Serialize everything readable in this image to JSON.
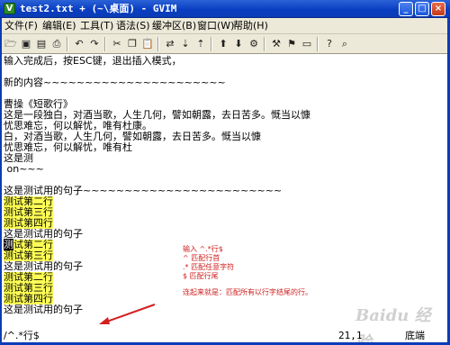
{
  "window": {
    "title": "test2.txt + (~\\桌面) - GVIM",
    "buttons": [
      "_",
      "□",
      "×"
    ]
  },
  "menu": [
    "文件(F)",
    "编辑(E)",
    "工具(T)",
    "语法(S)",
    "缓冲区(B)",
    "窗口(W)",
    "帮助(H)"
  ],
  "toolbar_icons": [
    "open-icon",
    "save-icon",
    "save-all-icon",
    "print-icon",
    "undo-icon",
    "redo-icon",
    "cut-icon",
    "copy-icon",
    "paste-icon",
    "find-icon",
    "find-next-icon",
    "find-prev-icon",
    "replace-icon",
    "load-session-icon",
    "save-session-icon",
    "run-script-icon",
    "make-icon",
    "run-ctags-icon",
    "jump-tag-icon",
    "help-icon",
    "find-help-icon"
  ],
  "editor": {
    "lines": [
      {
        "text": "输入完成后，按ESC键，退出插入模式，",
        "hl": false
      },
      {
        "text": "",
        "hl": false
      },
      {
        "text": "新的内容~~~~~~~~~~~~~~~~~~~~~~",
        "hl": false
      },
      {
        "text": "",
        "hl": false
      },
      {
        "text": "曹操《短歌行》",
        "hl": false
      },
      {
        "text": "这是一段独白，对酒当歌，人生几何，譬如朝露，去日苦多。慨当以慷",
        "hl": false
      },
      {
        "text": "忧思难忘，何以解忧，唯有杜康。",
        "hl": false
      },
      {
        "text": "白，对酒当歌，人生几何，譬如朝露，去日苦多。慨当以慷",
        "hl": false
      },
      {
        "text": "忧思难忘，何以解忧，唯有杜",
        "hl": false
      },
      {
        "text": "这是测",
        "hl": false
      },
      {
        "text": " on~~~",
        "hl": false
      },
      {
        "text": "",
        "hl": false
      },
      {
        "text": "这是测试用的句子~~~~~~~~~~~~~~~~~~~~~~~~",
        "hl": false
      },
      {
        "text": "测试第二行",
        "hl": true
      },
      {
        "text": "测试第三行",
        "hl": true
      },
      {
        "text": "测试第四行",
        "hl": true
      },
      {
        "text": "这是测试用的句子",
        "hl": false
      },
      {
        "text": "测试第二行",
        "hl": true,
        "cursor": true
      },
      {
        "text": "测试第三行",
        "hl": true
      },
      {
        "text": "这是测试用的句子",
        "hl": false
      },
      {
        "text": "测试第二行",
        "hl": true
      },
      {
        "text": "测试第三行",
        "hl": true
      },
      {
        "text": "测试第四行",
        "hl": true
      },
      {
        "text": "这是测试用的句子",
        "hl": false
      }
    ],
    "cursor_char": "测",
    "cursor_rest": "试第二行"
  },
  "annotation": {
    "lines": [
      "输入 ^.*行$",
      "^ 匹配行首",
      ".* 匹配任意字符",
      "$ 匹配行尾"
    ],
    "summary": "连起来就是：匹配所有以行字结尾的行。"
  },
  "statusbar": {
    "command": "/^.*行$",
    "position": "21,1",
    "scroll": "底端"
  },
  "watermark": "Baidu 经验"
}
